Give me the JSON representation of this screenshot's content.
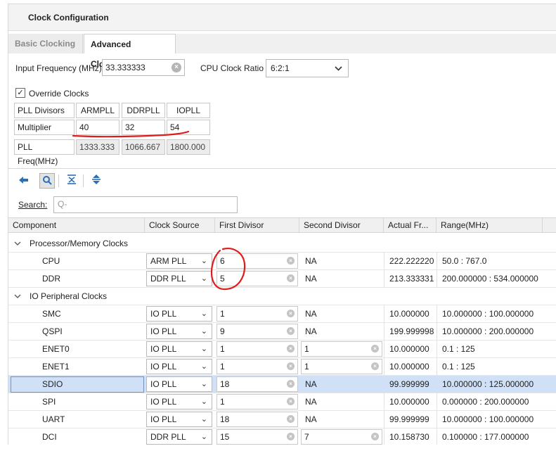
{
  "window": {
    "title": "Clock Configuration"
  },
  "tabs": [
    {
      "label": "Basic Clocking",
      "active": false
    },
    {
      "label": "Advanced Clocking",
      "active": true
    }
  ],
  "input_frequency": {
    "label": "Input Frequency (MHz)",
    "value": "33.333333"
  },
  "cpu_clock_ratio": {
    "label": "CPU Clock Ratio",
    "value": "6:2:1"
  },
  "override_clocks": {
    "label": "Override Clocks",
    "checked": true
  },
  "pll_grid": {
    "corner_label": "PLL Divisors",
    "columns": [
      "ARMPLL",
      "DDRPLL",
      "IOPLL"
    ],
    "multiplier_label": "Multiplier",
    "multipliers": [
      "40",
      "32",
      "54"
    ],
    "freq_label": "PLL Freq(MHz)",
    "freqs": [
      "1333.333",
      "1066.667",
      "1800.000"
    ]
  },
  "toolbar": {
    "icons": [
      "back-arrow-icon",
      "search-icon",
      "collapse-all-icon",
      "expand-all-icon"
    ]
  },
  "search": {
    "label": "Search:",
    "placeholder": "Q-"
  },
  "table": {
    "headers": [
      "Component",
      "Clock Source",
      "First Divisor",
      "Second Divisor",
      "Actual Fr...",
      "Range(MHz)"
    ],
    "groups": {
      "processor": "Processor/Memory Clocks",
      "io": "IO Peripheral Clocks"
    },
    "rows": [
      {
        "component": "CPU",
        "source": "ARM PLL",
        "div1": "6",
        "div2": "NA",
        "actual": "222.222220",
        "range": "50.0 : 767.0"
      },
      {
        "component": "DDR",
        "source": "DDR PLL",
        "div1": "5",
        "div2": "NA",
        "actual": "213.333331",
        "range": "200.000000 : 534.000000"
      },
      {
        "component": "SMC",
        "source": "IO PLL",
        "div1": "1",
        "div2": "NA",
        "actual": "10.000000",
        "range": "10.000000 : 100.000000"
      },
      {
        "component": "QSPI",
        "source": "IO PLL",
        "div1": "9",
        "div2": "NA",
        "actual": "199.999998",
        "range": "10.000000 : 200.000000"
      },
      {
        "component": "ENET0",
        "source": "IO PLL",
        "div1": "1",
        "div2": "1",
        "actual": "10.000000",
        "range": "0.1 : 125"
      },
      {
        "component": "ENET1",
        "source": "IO PLL",
        "div1": "1",
        "div2": "1",
        "actual": "10.000000",
        "range": "0.1 : 125"
      },
      {
        "component": "SDIO",
        "source": "IO PLL",
        "div1": "18",
        "div2": "NA",
        "actual": "99.999999",
        "range": "10.000000 : 125.000000"
      },
      {
        "component": "SPI",
        "source": "IO PLL",
        "div1": "1",
        "div2": "NA",
        "actual": "10.000000",
        "range": "0.000000 : 200.000000"
      },
      {
        "component": "UART",
        "source": "IO PLL",
        "div1": "18",
        "div2": "NA",
        "actual": "99.999999",
        "range": "10.000000 : 100.000000"
      },
      {
        "component": "DCI",
        "source": "DDR PLL",
        "div1": "15",
        "div2": "7",
        "actual": "10.158730",
        "range": "0.100000 : 177.000000"
      }
    ],
    "selected_row": "SDIO"
  },
  "colors": {
    "annotation_red": "#e01b1b",
    "selection_blue": "#cfe0f7",
    "icon_blue": "#2b6fb5"
  }
}
